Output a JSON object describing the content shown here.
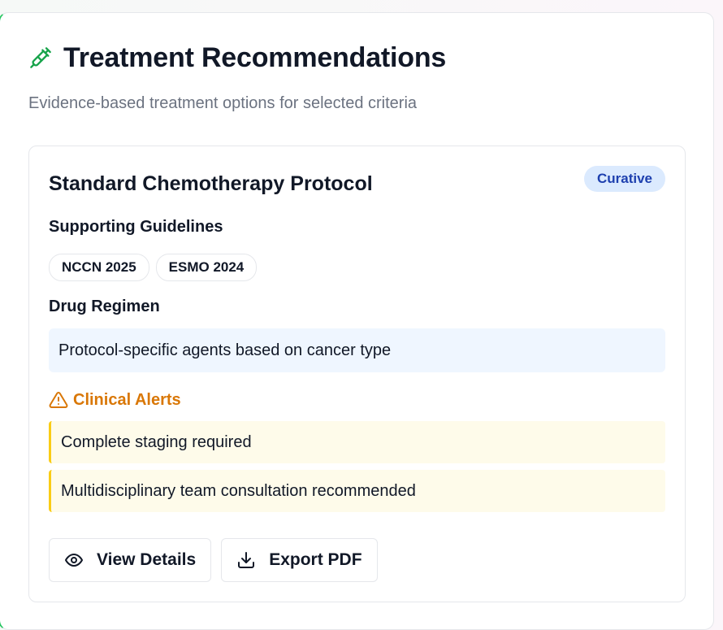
{
  "header": {
    "icon": "syringe-icon",
    "title": "Treatment Recommendations",
    "subtitle": "Evidence-based treatment options for selected criteria"
  },
  "recommendation": {
    "title": "Standard Chemotherapy Protocol",
    "badge": "Curative",
    "guidelines_label": "Supporting Guidelines",
    "guidelines": [
      "NCCN 2025",
      "ESMO 2024"
    ],
    "regimen_label": "Drug Regimen",
    "regimen": "Protocol-specific agents based on cancer type",
    "alerts_label": "Clinical Alerts",
    "alerts_icon": "warning-triangle-icon",
    "alerts": [
      "Complete staging required",
      "Multidisciplinary team consultation recommended"
    ],
    "actions": {
      "view_details": "View Details",
      "view_details_icon": "eye-icon",
      "export_pdf": "Export PDF",
      "export_pdf_icon": "download-icon"
    }
  },
  "colors": {
    "accent_green": "#22c55e",
    "badge_bg": "#dbeafe",
    "badge_text": "#1e40af",
    "alert_orange": "#d97706",
    "alert_bg": "#fefbea",
    "alert_border": "#facc15",
    "regimen_bg": "#eff6ff"
  }
}
